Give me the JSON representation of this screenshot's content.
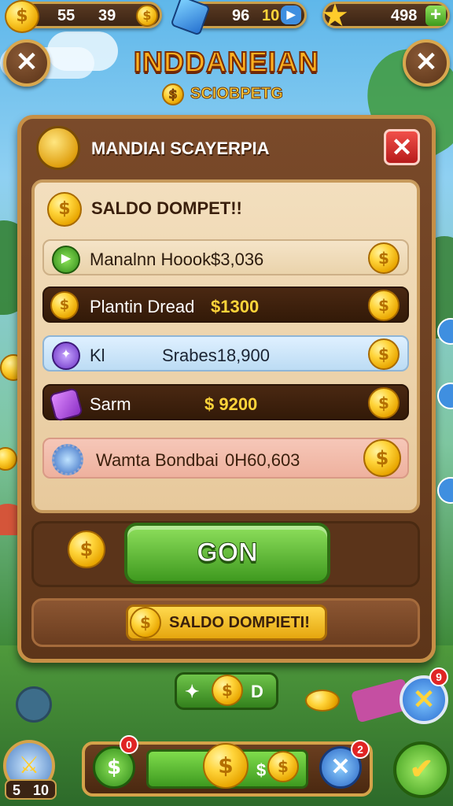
{
  "topbar": {
    "coins_a": "55",
    "coins_b": "39",
    "gems_a": "96",
    "gems_b": "10",
    "stars": "498",
    "add_label": "+"
  },
  "header": {
    "title": "INDDANEIAN",
    "subtitle": "SCIOBPETG"
  },
  "panel": {
    "title": "MANDIAI SCAYERPIA",
    "close_label": "✕",
    "balance_title": "SALDO DOMPET!!",
    "rows": [
      {
        "label": "Manalnn Hoook",
        "amount": "$3,036"
      },
      {
        "label": "Plantin Dread",
        "amount": "$1300"
      },
      {
        "label": "Kl",
        "amount": "Srabes18,900"
      },
      {
        "label": "Sarm",
        "amount": "$ 9200"
      },
      {
        "label": "Wamta Bondbai",
        "amount": "0H60,603"
      }
    ],
    "coin_symbol": "$",
    "action_label": "GON",
    "saldo_button_label": "SALDO DOMPIETI!"
  },
  "bottom": {
    "pill_label": "D",
    "lives": "5",
    "lives_max": "10",
    "badges": [
      "0",
      "2",
      "9"
    ]
  },
  "colors": {
    "accent_gold": "#ffd43a",
    "panel_brown": "#5d3519",
    "action_green": "#3f9a1f",
    "close_red": "#d12a2a"
  }
}
